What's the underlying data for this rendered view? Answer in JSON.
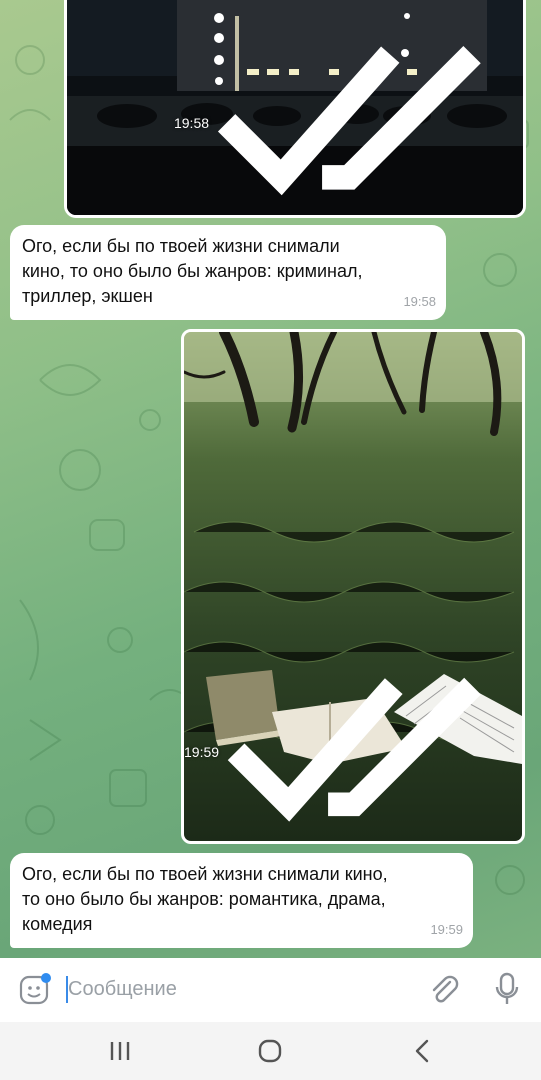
{
  "messages": [
    {
      "type": "photo",
      "description_icon": "night-building-photo",
      "time": "19:58",
      "status": "read"
    },
    {
      "type": "text",
      "text": "Ого, если бы по твоей жизни снимали\nкино, то оно было бы жанров: криминал,\nтриллер, экшен",
      "time": "19:58"
    },
    {
      "type": "photo",
      "description_icon": "books-in-grass-photo",
      "time": "19:59",
      "status": "read"
    },
    {
      "type": "text",
      "text": "Ого, если бы по твоей жизни снимали кино,\nто оно было бы жанров: романтика, драма,\nкомедия",
      "time": "19:59"
    }
  ],
  "input": {
    "placeholder": "Сообщение",
    "icons": [
      "sticker-icon",
      "paperclip-icon",
      "microphone-icon"
    ]
  },
  "navbar": {
    "icons": [
      "recent-apps-icon",
      "home-icon",
      "back-icon"
    ]
  },
  "colors": {
    "bubble": "#ffffff",
    "caret": "#3a8be8",
    "badge": "#2f8cf0",
    "meta_text": "#a0a4a8"
  }
}
